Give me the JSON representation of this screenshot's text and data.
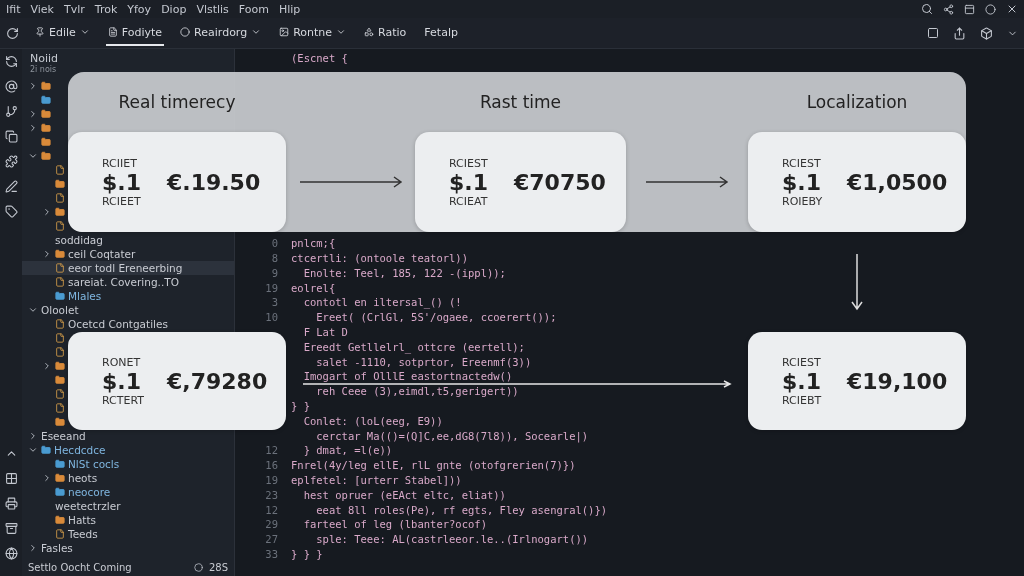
{
  "menu": [
    "Ifit",
    "Viek",
    "Tvlr",
    "Trok",
    "Yfoy",
    "Diop",
    "Vlstlis",
    "Foom",
    "Hlip"
  ],
  "toolbar": [
    {
      "label": "Edile",
      "dropdown": true,
      "selected": false
    },
    {
      "label": "Fodiyte",
      "dropdown": false,
      "selected": true
    },
    {
      "label": "Reairdorg",
      "dropdown": true,
      "selected": false
    },
    {
      "label": "Rontne",
      "dropdown": true,
      "selected": false
    },
    {
      "label": "Ratio",
      "dropdown": false,
      "selected": false
    },
    {
      "label": "Fetalp",
      "dropdown": false,
      "selected": false
    }
  ],
  "sidebar": {
    "title": "Noiid",
    "subtitle": "2i nois",
    "tree": [
      {
        "kind": "folder",
        "expanded": false
      },
      {
        "kind": "blue"
      },
      {
        "kind": "folder",
        "expanded": false
      },
      {
        "kind": "folder",
        "expanded": false
      },
      {
        "kind": "folder"
      },
      {
        "kind": "folder",
        "expanded": true,
        "children": [
          {
            "kind": "file"
          },
          {
            "kind": "folder"
          },
          {
            "kind": "file"
          },
          {
            "kind": "folder",
            "expanded": false
          },
          {
            "kind": "file"
          },
          {
            "kind": "plain",
            "label": "soddidag"
          },
          {
            "kind": "folder",
            "expanded": false,
            "label": "ceil Coqtater"
          },
          {
            "kind": "file",
            "label": "eeor todl Ereneerbing",
            "selected": true
          },
          {
            "kind": "file",
            "label": "sareiat. Covering..TO"
          },
          {
            "kind": "blue",
            "label": "Mlales"
          }
        ]
      },
      {
        "kind": "plain",
        "expanded": true,
        "label": "Oloolet",
        "children": [
          {
            "kind": "file",
            "label": "Ocetcd Contgatiles"
          },
          {
            "kind": "file"
          },
          {
            "kind": "file"
          },
          {
            "kind": "folder",
            "expanded": false
          },
          {
            "kind": "folder"
          },
          {
            "kind": "file"
          },
          {
            "kind": "file"
          },
          {
            "kind": "folder"
          }
        ]
      },
      {
        "kind": "plain",
        "expanded": false,
        "label": "Eseeand"
      },
      {
        "kind": "blue",
        "expanded": true,
        "label": "Hecdcdce",
        "children": [
          {
            "kind": "blue",
            "label": "NlSt cocls"
          },
          {
            "kind": "folder",
            "expanded": false,
            "label": "heots"
          },
          {
            "kind": "blue",
            "label": "neocore"
          },
          {
            "kind": "plain",
            "label": "weetectrzler"
          },
          {
            "kind": "folder",
            "label": "Hatts"
          },
          {
            "kind": "file",
            "label": "Teeds"
          }
        ]
      },
      {
        "kind": "plain",
        "expanded": false,
        "label": "Fasles"
      }
    ],
    "status": "Settlo Oocht Coming",
    "count": "28S"
  },
  "code": [
    {
      "text": "(Escnet {"
    },
    {
      "num": "0",
      "text": "pnlcm;{",
      "gap": true
    },
    {
      "num": "8",
      "text": "ctcertli: (ontoole teatorl))"
    },
    {
      "num": "9",
      "text": "  Enolte: Teel, 185, 122 -(ippl));"
    },
    {
      "num": "19",
      "text": "eolrel{"
    },
    {
      "num": "3",
      "text": "  contotl en iltersal_() (!"
    },
    {
      "num": "10",
      "text": "    Ereet( (CrlGl, 5S'/ogaee, ccoerert());"
    },
    {
      "text": "  F Lat D"
    },
    {
      "text": "  Ereedt Getllelrl_ ottcre (eertell);"
    },
    {
      "text": "    salet -1110, sotprtor, Ereenmf(3))"
    },
    {
      "text": "  Imogart of OlllE eastortnactedw()"
    },
    {
      "text": "    reh Ceee (3),eimdl,t5,gerigert))"
    },
    {
      "text": "} }"
    },
    {
      "text": "  Conlet: (loL(eeg, E9))"
    },
    {
      "text": "    cerctar Ma(()=(Q]C,ee,dG8(7l8)), Socearle|)"
    },
    {
      "num": "12",
      "text": "  } dmat, =l(e))"
    },
    {
      "num": "16",
      "text": "Fnrel(4y/leg ellE, rlL gnte (otofgrerien(7)})"
    },
    {
      "num": "19",
      "text": "eplfetel: [urterr Stabel]))"
    },
    {
      "num": "23",
      "text": "  hest opruer (eEAct eltc, eliat))"
    },
    {
      "num": "12",
      "text": "    eeat 8ll roles(Pe), rf egts, Fley asengral()})"
    },
    {
      "num": "29",
      "text": "  farteel of leg (lbanter?ocof)"
    },
    {
      "num": "27",
      "text": "    sple: Teee: AL(castrleeor.le..(Irlnogart())"
    },
    {
      "num": "33",
      "text": "} } }"
    }
  ],
  "flow": {
    "titles": [
      "Real timerecy",
      "Rast time",
      "Localization"
    ],
    "cards": [
      {
        "top": "RCIIET",
        "amount": "$.1",
        "value": "€.19.50",
        "bottom": "RCIEET"
      },
      {
        "top": "RCIEST",
        "amount": "$.1",
        "value": "€70750",
        "bottom": "RCIEAT"
      },
      {
        "top": "RCIEST",
        "amount": "$.1",
        "value": "€1,0500",
        "bottom": "ROIEBY"
      },
      {
        "top": "RONET",
        "amount": "$.1",
        "value": "€,79280",
        "bottom": "RCTERT"
      },
      {
        "top": "RCIEST",
        "amount": "$.1",
        "value": "€19,100",
        "bottom": "RCIEBT"
      }
    ]
  }
}
